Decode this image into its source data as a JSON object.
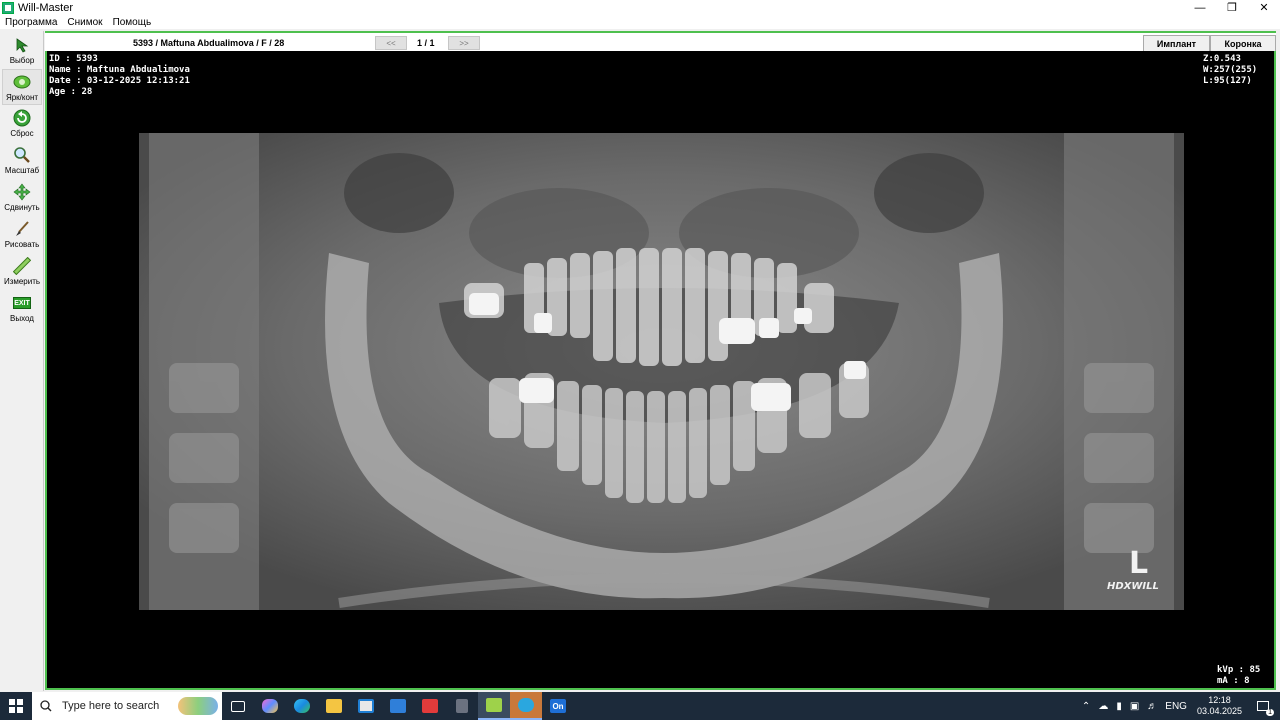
{
  "window": {
    "title": "Will-Master"
  },
  "menu": [
    "Программа",
    "Снимок",
    "Помощь"
  ],
  "toolbar": [
    {
      "label": "Выбор",
      "icon": "pointer-arrow-icon"
    },
    {
      "label": "Ярк/конт",
      "icon": "brightness-contrast-icon"
    },
    {
      "label": "Сброс",
      "icon": "reset-icon"
    },
    {
      "label": "Масштаб",
      "icon": "magnifier-icon"
    },
    {
      "label": "Сдвинуть",
      "icon": "move-icon"
    },
    {
      "label": "Рисовать",
      "icon": "brush-icon"
    },
    {
      "label": "Измерить",
      "icon": "ruler-icon"
    },
    {
      "label": "Выход",
      "icon": "exit-icon",
      "badge": "EXIT"
    }
  ],
  "viewer_top": {
    "patient": "5393 / Maftuna Abdualimova / F / 28",
    "prev": "<<",
    "page": "1 / 1",
    "next": ">>",
    "tab_implant": "Имплант",
    "tab_crown": "Коронка"
  },
  "overlay": {
    "id": "ID : 5393",
    "name": "Name : Maftuna Abdualimova",
    "date": "Date : 03-12-2025 12:13:21",
    "age": "Age : 28",
    "zoom": "Z:0.543",
    "width": "W:257(255)",
    "level": "L:95(127)",
    "kvp": "kVp : 85",
    "ma": "mA : 8",
    "side_marker": "L",
    "brand": "HDXWILL"
  },
  "taskbar": {
    "search_placeholder": "Type here to search",
    "language": "ENG",
    "time": "12:18",
    "date": "03.04.2025",
    "notification_count": "1"
  },
  "colors": {
    "frame_green": "#4ec04e",
    "taskbar": "#1c2a3a"
  }
}
